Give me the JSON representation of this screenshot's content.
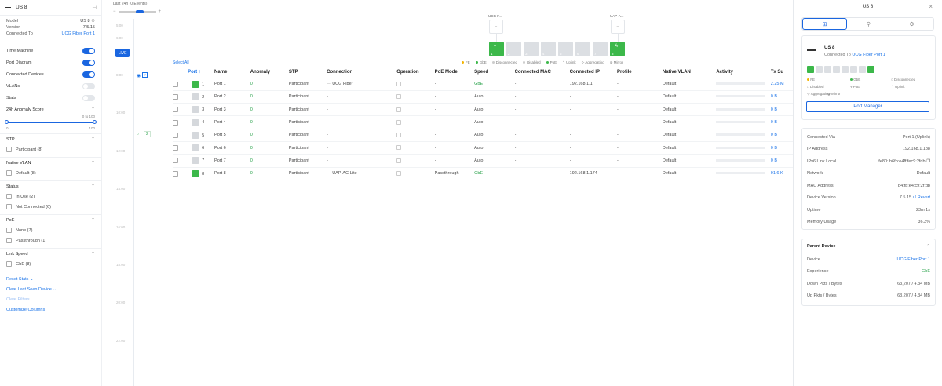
{
  "left": {
    "device_name": "US 8",
    "info": [
      {
        "label": "Model",
        "value": "US 8"
      },
      {
        "label": "Version",
        "value": "7.5.15"
      },
      {
        "label": "Connected To",
        "value": "UCG Fiber Port 1"
      }
    ],
    "toggles": [
      {
        "label": "Time Machine",
        "on": true
      },
      {
        "label": "Port Diagram",
        "on": true
      },
      {
        "label": "Connected Devices",
        "on": true
      },
      {
        "label": "VLANs",
        "on": false
      },
      {
        "label": "Stats",
        "on": false
      }
    ],
    "anomaly": {
      "title": "24h Anomaly Score",
      "hint": "0 to 100",
      "min": "0",
      "max": "100"
    },
    "filters": [
      {
        "title": "STP",
        "options": [
          "Participant (8)"
        ]
      },
      {
        "title": "Native VLAN",
        "options": [
          "Default (8)"
        ]
      },
      {
        "title": "Status",
        "options": [
          "In Use (2)",
          "Not Connected (6)"
        ]
      },
      {
        "title": "PoE",
        "options": [
          "None (7)",
          "Passthrough (1)"
        ]
      },
      {
        "title": "Link Speed",
        "options": [
          "GbE (8)"
        ]
      }
    ],
    "links": {
      "reset": "Reset Stats",
      "clear_last": "Clear Last Seen Device",
      "clear_filters": "Clear Filters",
      "customize": "Customize Columns"
    }
  },
  "timemachine": {
    "range_label": "Last 24h (0 Events)",
    "live": "LIVE",
    "times": [
      "5:00",
      "6:00",
      "8:00",
      "10:00",
      "12:00",
      "14:00",
      "16:00",
      "18:00",
      "20:00",
      "22:00"
    ],
    "event_count": "2"
  },
  "diagram": {
    "upstream": [
      {
        "name": "UCG F..."
      },
      {
        "name": "UAP-A..."
      }
    ],
    "ports": [
      {
        "n": "1",
        "up": true
      },
      {
        "n": "2",
        "up": false
      },
      {
        "n": "3",
        "up": false
      },
      {
        "n": "4",
        "up": false
      },
      {
        "n": "5",
        "up": false
      },
      {
        "n": "6",
        "up": false
      },
      {
        "n": "7",
        "up": false
      },
      {
        "n": "8",
        "up": true
      }
    ],
    "legend": [
      "FE",
      "GbE",
      "Disconnected",
      "Disabled",
      "PoE",
      "Uplink",
      "Aggregating",
      "Mirror"
    ]
  },
  "table": {
    "select_all": "Select All",
    "columns": [
      "Port",
      "Name",
      "Anomaly",
      "STP",
      "Connection",
      "Operation",
      "PoE Mode",
      "Speed",
      "Connected MAC",
      "Connected IP",
      "Profile",
      "Native VLAN",
      "Activity",
      "Tx Su"
    ],
    "rows": [
      {
        "port": "1",
        "up": true,
        "name": "Port 1",
        "anomaly": "0",
        "stp": "Participant",
        "connection": "UCG Fiber",
        "poe": "-",
        "speed": "GbE",
        "mac": "-",
        "ip": "192.168.1.1",
        "profile": "-",
        "vlan": "Default",
        "tx": "2.25 M"
      },
      {
        "port": "2",
        "up": false,
        "name": "Port 2",
        "anomaly": "0",
        "stp": "Participant",
        "connection": "-",
        "poe": "-",
        "speed": "Auto",
        "mac": "-",
        "ip": "-",
        "profile": "-",
        "vlan": "Default",
        "tx": "0 B"
      },
      {
        "port": "3",
        "up": false,
        "name": "Port 3",
        "anomaly": "0",
        "stp": "Participant",
        "connection": "-",
        "poe": "-",
        "speed": "Auto",
        "mac": "-",
        "ip": "-",
        "profile": "-",
        "vlan": "Default",
        "tx": "0 B"
      },
      {
        "port": "4",
        "up": false,
        "name": "Port 4",
        "anomaly": "0",
        "stp": "Participant",
        "connection": "-",
        "poe": "-",
        "speed": "Auto",
        "mac": "-",
        "ip": "-",
        "profile": "-",
        "vlan": "Default",
        "tx": "0 B"
      },
      {
        "port": "5",
        "up": false,
        "name": "Port 5",
        "anomaly": "0",
        "stp": "Participant",
        "connection": "-",
        "poe": "-",
        "speed": "Auto",
        "mac": "-",
        "ip": "-",
        "profile": "-",
        "vlan": "Default",
        "tx": "0 B"
      },
      {
        "port": "6",
        "up": false,
        "name": "Port 6",
        "anomaly": "0",
        "stp": "Participant",
        "connection": "-",
        "poe": "-",
        "speed": "Auto",
        "mac": "-",
        "ip": "-",
        "profile": "-",
        "vlan": "Default",
        "tx": "0 B"
      },
      {
        "port": "7",
        "up": false,
        "name": "Port 7",
        "anomaly": "0",
        "stp": "Participant",
        "connection": "-",
        "poe": "-",
        "speed": "Auto",
        "mac": "-",
        "ip": "-",
        "profile": "-",
        "vlan": "Default",
        "tx": "0 B"
      },
      {
        "port": "8",
        "up": true,
        "name": "Port 8",
        "anomaly": "0",
        "stp": "Participant",
        "connection": "UAP-AC-Lite",
        "poe": "Passthrough",
        "speed": "GbE",
        "mac": "-",
        "ip": "192.168.1.174",
        "profile": "-",
        "vlan": "Default",
        "tx": "91.6 K"
      }
    ]
  },
  "right": {
    "title": "US 8",
    "device": {
      "name": "US 8",
      "connected_prefix": "Connected To",
      "connected_link": "UCG Fiber Port 1"
    },
    "mini_legend": [
      "FE",
      "GbE",
      "Disconnected",
      "Disabled",
      "PoE",
      "Uplink",
      "Aggregating",
      "Mirror"
    ],
    "port_manager": "Port Manager",
    "details": [
      {
        "label": "Connected Via",
        "value": "Port 1 (Uplink)"
      },
      {
        "label": "IP Address",
        "value": "192.168.1.188"
      },
      {
        "label": "IPv6 Link Local",
        "value": "fe80::b6fb:e4ff:fec9:2fdb"
      },
      {
        "label": "Network",
        "value": "Default"
      },
      {
        "label": "MAC Address",
        "value": "b4:fb:e4:c9:2f:db"
      },
      {
        "label": "Device Version",
        "value": "7.5.15",
        "extra": "Revert"
      },
      {
        "label": "Uptime",
        "value": "23m 1s"
      },
      {
        "label": "Memory Usage",
        "value": "36.3%"
      }
    ],
    "parent": {
      "title": "Parent Device",
      "rows": [
        {
          "label": "Device",
          "value": "UCG Fiber Port 1"
        },
        {
          "label": "Experience",
          "value": "GbE"
        },
        {
          "label": "Down Pkts / Bytes",
          "value": "63,207 / 4.34 MB"
        },
        {
          "label": "Up Pkts / Bytes",
          "value": "63,207 / 4.34 MB"
        }
      ]
    }
  }
}
